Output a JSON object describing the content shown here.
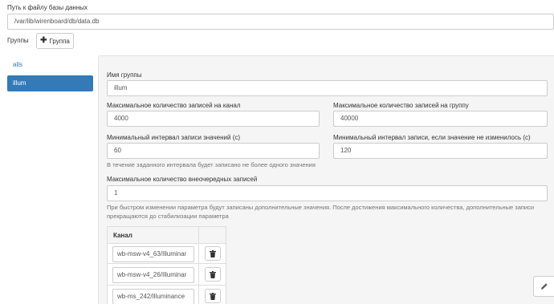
{
  "db_path": {
    "label": "Путь к файлу базы данных",
    "value": "/var/lib/wirenboard/db/data.db"
  },
  "groups": {
    "label": "Группы",
    "add_button_label": "Группа",
    "items": [
      {
        "label": "alls",
        "active": false
      },
      {
        "label": "illum",
        "active": true
      }
    ]
  },
  "form": {
    "group_name_label": "Имя группы",
    "group_name_value": "illum",
    "max_records_channel_label": "Максимальное количество записей на канал",
    "max_records_channel_value": "4000",
    "max_records_group_label": "Максимальное количество записей на группу",
    "max_records_group_value": "40000",
    "min_interval_label": "Минимальный интервал записи значений (с)",
    "min_interval_value": "60",
    "min_interval_help": "В течение заданного интервала будет записано не более одного значения",
    "min_interval_unchanged_label": "Минимальный интервал записи, если значение не изменилось (с)",
    "min_interval_unchanged_value": "120",
    "max_extra_label": "Максимальное количество внеочередных записей",
    "max_extra_value": "1",
    "max_extra_help": "При быстром изменении параметра будут записаны дополнительные значения. После достижения максимального количества, дополнительные записи прекращаются до стабилизации параметра"
  },
  "channels": {
    "header": "Канал",
    "rows": [
      {
        "value": "wb-msw-v4_63/Illuminar"
      },
      {
        "value": "wb-msw-v4_26/Illuminar"
      },
      {
        "value": "wb-ms_242/Illuminance"
      }
    ]
  },
  "colors": {
    "active_bg": "#337ab7",
    "link": "#337ab7",
    "panel_bg": "#f5f5f5"
  },
  "icons": {
    "add": "plus-icon",
    "delete": "trash-icon",
    "edit": "pencil-icon"
  }
}
